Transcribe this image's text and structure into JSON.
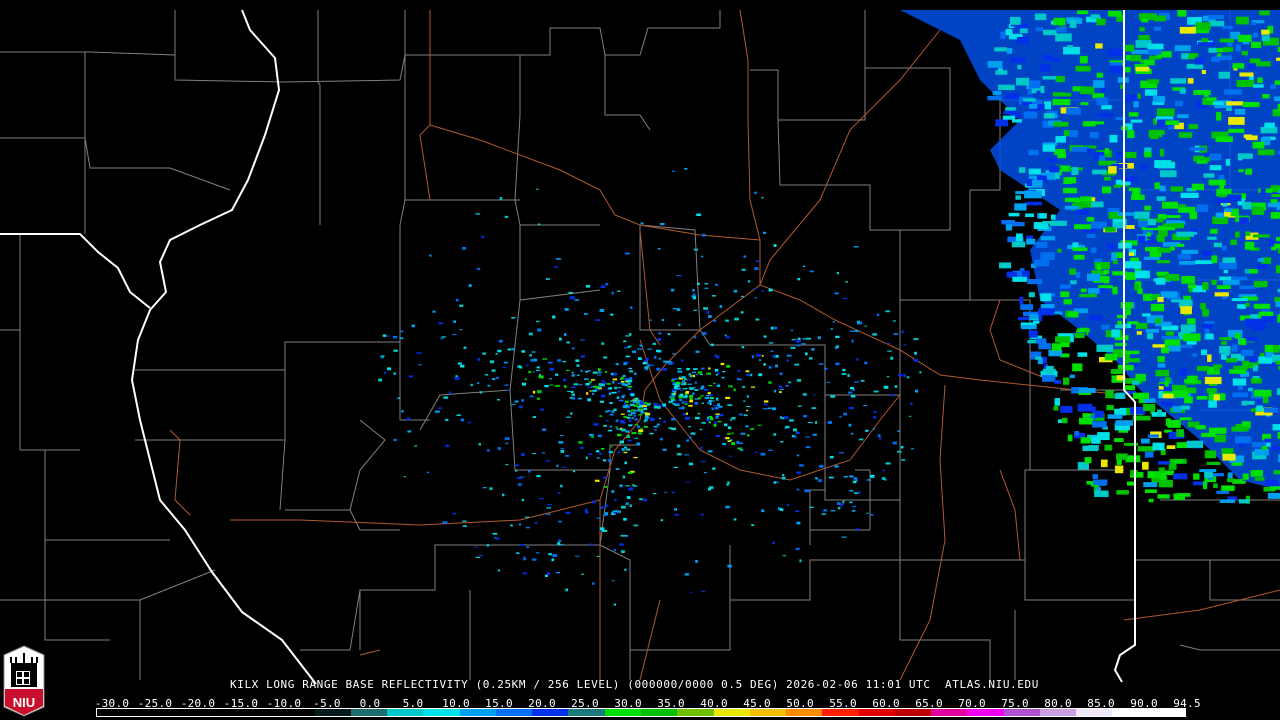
{
  "product": {
    "caption": "KILX LONG RANGE BASE REFLECTIVITY (0.25KM / 256 LEVEL) (000000/0000 0.5 DEG) 2026-02-06 11:01 UTC  ATLAS.NIU.EDU"
  },
  "logo": {
    "text": "NIU"
  },
  "legend": {
    "ticks": [
      "-30.0",
      "-25.0",
      "-20.0",
      "-15.0",
      "-10.0",
      "-5.0",
      "0.0",
      "5.0",
      "10.0",
      "15.0",
      "20.0",
      "25.0",
      "30.0",
      "35.0",
      "40.0",
      "45.0",
      "50.0",
      "55.0",
      "60.0",
      "65.0",
      "70.0",
      "75.0",
      "80.0",
      "85.0",
      "90.0",
      "94.5"
    ],
    "colors": [
      "#000000",
      "#000000",
      "#000000",
      "#000000",
      "#000000",
      "#000000",
      "#071a1a",
      "#1c6e6e",
      "#00c8c8",
      "#00e0e8",
      "#00a0f0",
      "#0070f0",
      "#0030e8",
      "#1a7a7a",
      "#00e000",
      "#00c000",
      "#70c000",
      "#e8e800",
      "#f0c000",
      "#ff8c00",
      "#ff2000",
      "#e00000",
      "#c00000",
      "#e000a0",
      "#f000f0",
      "#b050d0",
      "#c8a0e0",
      "#f0e8f8",
      "#ffffff",
      "#ffffff"
    ]
  },
  "colors": {
    "state_border": "#ffffff",
    "county_line": "#8a8a8a",
    "highway": "#b05a30"
  }
}
